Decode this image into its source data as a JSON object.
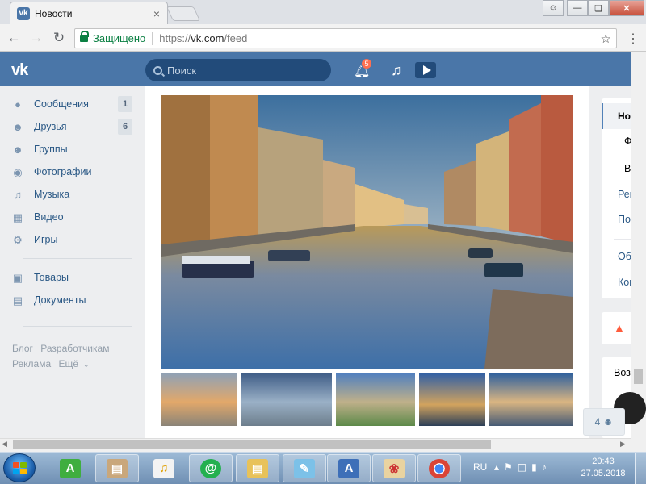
{
  "browser": {
    "tab_title": "Новости",
    "tab_favicon": "vk-logo-icon",
    "secure_label": "Защищено",
    "url_scheme": "https://",
    "url_host": "vk.com",
    "url_path": "/feed"
  },
  "vk": {
    "logo": "vk",
    "search_placeholder": "Поиск",
    "notifications_count": "5",
    "brand_color": "#4a76a8"
  },
  "leftnav": {
    "items": [
      {
        "label": "Сообщения",
        "icon": "messages-icon",
        "count": "1"
      },
      {
        "label": "Друзья",
        "icon": "friends-icon",
        "count": "6"
      },
      {
        "label": "Группы",
        "icon": "groups-icon",
        "count": ""
      },
      {
        "label": "Фотографии",
        "icon": "camera-icon",
        "count": ""
      },
      {
        "label": "Музыка",
        "icon": "music-note-icon",
        "count": ""
      },
      {
        "label": "Видео",
        "icon": "film-icon",
        "count": ""
      },
      {
        "label": "Игры",
        "icon": "gamepad-icon",
        "count": ""
      },
      {
        "label": "Товары",
        "icon": "shopping-bag-icon",
        "count": ""
      },
      {
        "label": "Документы",
        "icon": "document-icon",
        "count": ""
      }
    ],
    "footer": [
      "Блог",
      "Разработчикам",
      "Реклама",
      "Ещё"
    ]
  },
  "right": {
    "items": [
      "Новости",
      "Ф",
      "Вы",
      "Рек",
      "Пои",
      "Обн",
      "Ком"
    ],
    "possible_friends": "Возм"
  },
  "online_friends": "4",
  "taskbar": {
    "lang": "RU",
    "time": "20:43",
    "date": "27.05.2018"
  }
}
